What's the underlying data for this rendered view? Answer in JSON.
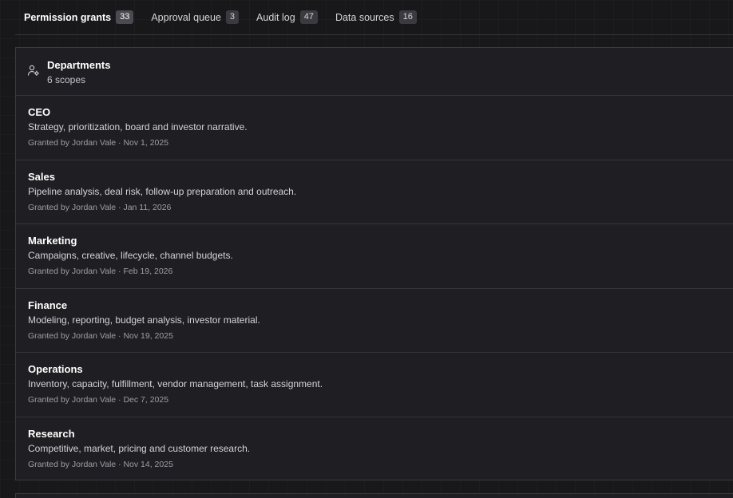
{
  "tabs": [
    {
      "label": "Permission grants",
      "count": "33",
      "active": true
    },
    {
      "label": "Approval queue",
      "count": "3",
      "active": false
    },
    {
      "label": "Audit log",
      "count": "47",
      "active": false
    },
    {
      "label": "Data sources",
      "count": "16",
      "active": false
    }
  ],
  "panel": {
    "icon": "user-cog-icon",
    "title": "Departments",
    "subtitle": "6 scopes"
  },
  "departments": [
    {
      "name": "CEO",
      "description": "Strategy, prioritization, board and investor narrative.",
      "granted": "Granted by Jordan Vale · Nov 1, 2025"
    },
    {
      "name": "Sales",
      "description": "Pipeline analysis, deal risk, follow-up preparation and outreach.",
      "granted": "Granted by Jordan Vale · Jan 11, 2026"
    },
    {
      "name": "Marketing",
      "description": "Campaigns, creative, lifecycle, channel budgets.",
      "granted": "Granted by Jordan Vale · Feb 19, 2026"
    },
    {
      "name": "Finance",
      "description": "Modeling, reporting, budget analysis, investor material.",
      "granted": "Granted by Jordan Vale · Nov 19, 2025"
    },
    {
      "name": "Operations",
      "description": "Inventory, capacity, fulfillment, vendor management, task assignment.",
      "granted": "Granted by Jordan Vale · Dec 7, 2025"
    },
    {
      "name": "Research",
      "description": "Competitive, market, pricing and customer research.",
      "granted": "Granted by Jordan Vale · Nov 14, 2025"
    }
  ]
}
